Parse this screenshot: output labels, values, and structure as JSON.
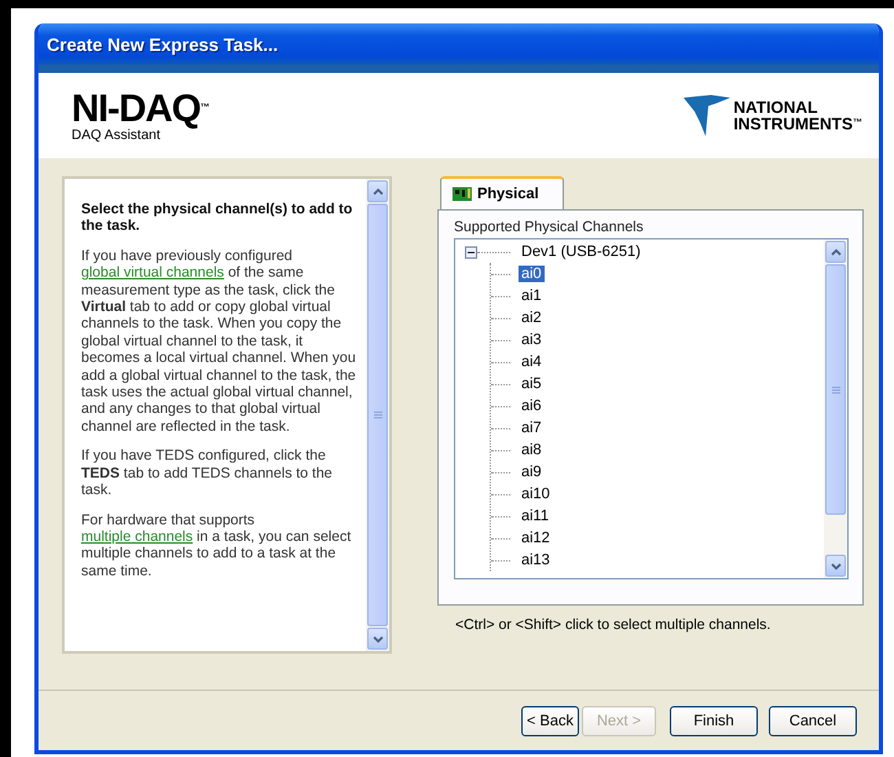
{
  "window": {
    "title": "Create New Express Task..."
  },
  "header": {
    "product": "NI-DAQ",
    "trademark": "™",
    "subtitle": "DAQ Assistant",
    "brand_line_1": "NATIONAL",
    "brand_line_2": "INSTRUMENTS",
    "brand_trademark": "™"
  },
  "help": {
    "heading": "Select the physical channel(s) to add to the task.",
    "paragraphs": [
      [
        {
          "kind": "text",
          "text": "If you have previously configured "
        },
        {
          "kind": "link",
          "text": "global virtual channels"
        },
        {
          "kind": "text",
          "text": " of the same measurement type as the task, click the **Virtual** tab to add or copy global virtual channels to the task. When you copy the global virtual channel to the task, it becomes a local virtual channel. When you add a global virtual channel to the task, the task uses the actual global virtual channel, and any changes to that global virtual channel are reflected in the task."
        }
      ],
      [
        {
          "kind": "text",
          "text": "If you have TEDS configured, click the **TEDS** tab to add TEDS channels to the task."
        }
      ],
      [
        {
          "kind": "text",
          "text": "For hardware that supports "
        },
        {
          "kind": "link",
          "text": "multiple channels"
        },
        {
          "kind": "text",
          "text": " in a task, you can select multiple channels to add to a task at the same time."
        }
      ]
    ]
  },
  "tabs": [
    {
      "label": "Physical",
      "selected": true
    }
  ],
  "channels": {
    "label": "Supported Physical Channels",
    "tree": [
      {
        "label": "Dev1  (USB-6251)",
        "expanded": true,
        "children": [
          {
            "label": "ai0",
            "selected": true
          },
          {
            "label": "ai1",
            "selected": false
          },
          {
            "label": "ai2",
            "selected": false
          },
          {
            "label": "ai3",
            "selected": false
          },
          {
            "label": "ai4",
            "selected": false
          },
          {
            "label": "ai5",
            "selected": false
          },
          {
            "label": "ai6",
            "selected": false
          },
          {
            "label": "ai7",
            "selected": false
          },
          {
            "label": "ai8",
            "selected": false
          },
          {
            "label": "ai9",
            "selected": false
          },
          {
            "label": "ai10",
            "selected": false
          },
          {
            "label": "ai11",
            "selected": false
          },
          {
            "label": "ai12",
            "selected": false
          },
          {
            "label": "ai13",
            "selected": false
          }
        ]
      }
    ],
    "hint": "<Ctrl> or <Shift> click to select multiple channels."
  },
  "buttons": [
    {
      "label": "< Back",
      "disabled": false
    },
    {
      "label": "Next >",
      "disabled": true
    },
    {
      "label": "Finish",
      "disabled": false
    },
    {
      "label": "Cancel",
      "disabled": false
    }
  ]
}
